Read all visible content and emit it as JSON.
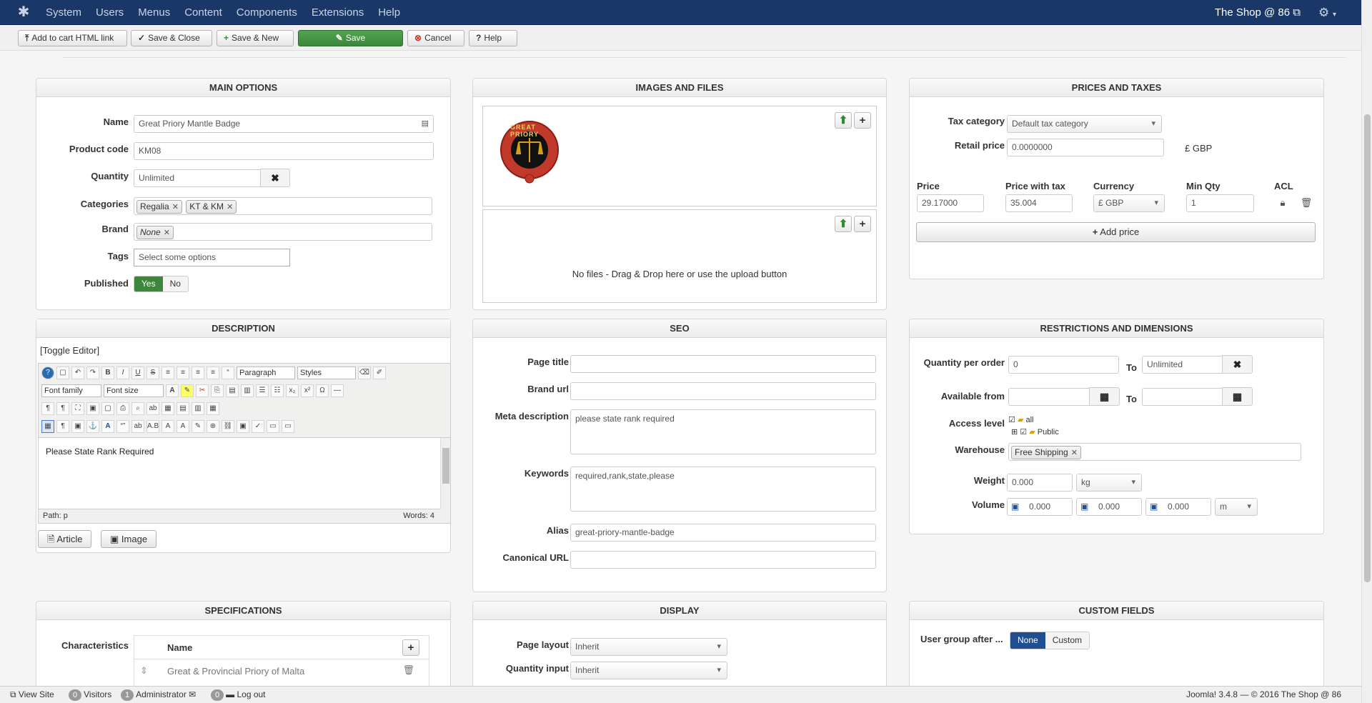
{
  "navbar": {
    "menu": [
      "System",
      "Users",
      "Menus",
      "Content",
      "Components",
      "Extensions",
      "Help"
    ],
    "site_name": "The Shop @ 86"
  },
  "toolbar": {
    "add_to_cart": "Add to cart HTML link",
    "save_close": "Save & Close",
    "save_new": "Save & New",
    "save": "Save",
    "cancel": "Cancel",
    "help": "Help"
  },
  "main_options": {
    "title": "MAIN OPTIONS",
    "name_label": "Name",
    "name_value": "Great Priory Mantle Badge",
    "code_label": "Product code",
    "code_value": "KM08",
    "qty_label": "Quantity",
    "qty_value": "Unlimited",
    "categories_label": "Categories",
    "categories": [
      "Regalia",
      "KT & KM"
    ],
    "brand_label": "Brand",
    "brand": "None",
    "tags_label": "Tags",
    "tags_placeholder": "Select some options",
    "published_label": "Published",
    "yes": "Yes",
    "no": "No"
  },
  "images": {
    "title": "IMAGES AND FILES",
    "badge_text": "GREAT PRIORY",
    "no_files": "No files - Drag & Drop here or use the upload button"
  },
  "prices": {
    "title": "PRICES AND TAXES",
    "tax_label": "Tax category",
    "tax_value": "Default tax category",
    "retail_label": "Retail price",
    "retail_value": "0.0000000",
    "retail_currency": "£ GBP",
    "col_price": "Price",
    "col_price_tax": "Price with tax",
    "col_currency": "Currency",
    "col_min_qty": "Min Qty",
    "col_acl": "ACL",
    "price": "29.17000",
    "price_tax": "35.004",
    "currency": "£ GBP",
    "min_qty": "1",
    "add_price": "Add price"
  },
  "description": {
    "title": "DESCRIPTION",
    "toggle": "[Toggle Editor]",
    "format": "Paragraph",
    "styles": "Styles",
    "font_family": "Font family",
    "font_size": "Font size",
    "body": "Please State Rank Required",
    "path": "Path: p",
    "words": "Words: 4",
    "article_btn": "Article",
    "image_btn": "Image"
  },
  "seo": {
    "title": "SEO",
    "page_title_label": "Page title",
    "page_title_value": "",
    "brand_url_label": "Brand url",
    "brand_url_value": "",
    "meta_label": "Meta description",
    "meta_value": "please state rank required",
    "keywords_label": "Keywords",
    "keywords_value": "required,rank,state,please",
    "alias_label": "Alias",
    "alias_value": "great-priory-mantle-badge",
    "canonical_label": "Canonical URL",
    "canonical_value": ""
  },
  "restrictions": {
    "title": "RESTRICTIONS AND DIMENSIONS",
    "qpo_label": "Quantity per order",
    "qpo_from": "0",
    "to": "To",
    "qpo_to": "Unlimited",
    "available_label": "Available from",
    "access_label": "Access level",
    "access_all": "all",
    "access_public": "Public",
    "warehouse_label": "Warehouse",
    "warehouse": "Free Shipping",
    "weight_label": "Weight",
    "weight_value": "0.000",
    "weight_unit": "kg",
    "volume_label": "Volume",
    "vol1": "0.000",
    "vol2": "0.000",
    "vol3": "0.000",
    "vol_unit": "m"
  },
  "specs": {
    "title": "SPECIFICATIONS",
    "char_label": "Characteristics",
    "col_name": "Name",
    "row1": "Great & Provincial Priory of Malta"
  },
  "display": {
    "title": "DISPLAY",
    "layout_label": "Page layout",
    "layout_value": "Inherit",
    "qty_input_label": "Quantity input",
    "qty_input_value": "Inherit"
  },
  "custom": {
    "title": "CUSTOM FIELDS",
    "ug_label": "User group after ...",
    "none": "None",
    "custom": "Custom"
  },
  "statusbar": {
    "view_site": "View Site",
    "visitors_count": "0",
    "visitors": "Visitors",
    "admin_count": "1",
    "admin": "Administrator",
    "msg_count": "0",
    "logout": "Log out",
    "footer": "Joomla! 3.4.8  —  © 2016 The Shop @ 86"
  },
  "colors": {
    "navbar": "#1a3867",
    "success": "#3b873b",
    "primary": "#1f4e91"
  }
}
